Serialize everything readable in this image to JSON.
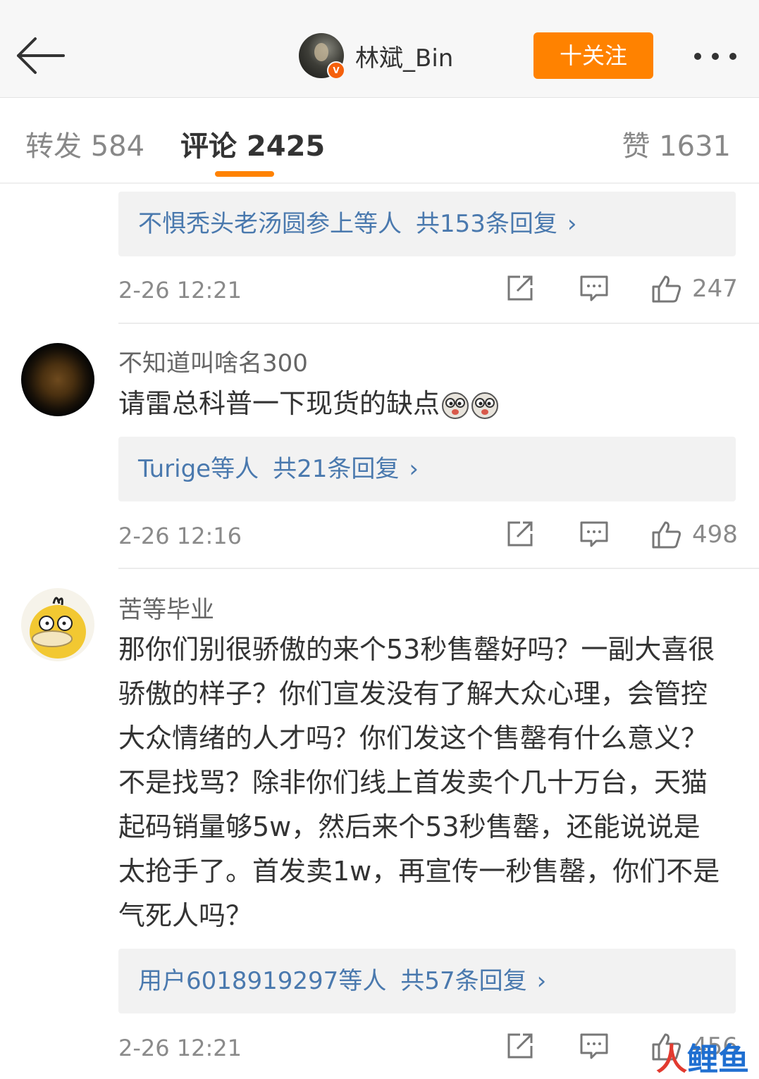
{
  "header": {
    "username": "林斌_Bin",
    "verified_badge": "V",
    "follow_label": "十关注",
    "accent_color": "#ff8200"
  },
  "tabs": {
    "repost": "转发 584",
    "comment": "评论 2425",
    "like": "赞 1631",
    "active": "comment"
  },
  "comments": [
    {
      "partial": true,
      "replies": {
        "names": "不惧秃头老汤圆参上等人",
        "count": "共153条回复",
        "chevron": "›"
      },
      "time": "2-26 12:21",
      "likes": "247"
    },
    {
      "name": "不知道叫啥名300",
      "text": "请雷总科普一下现货的缺点",
      "emojis": [
        "doge-emoji",
        "doge-emoji"
      ],
      "replies": {
        "names": "Turige等人",
        "count": "共21条回复",
        "chevron": "›"
      },
      "time": "2-26 12:16",
      "likes": "498"
    },
    {
      "name": "苦等毕业",
      "text": "那你们别很骄傲的来个53秒售罄好吗？一副大喜很骄傲的样子？你们宣发没有了解大众心理，会管控大众情绪的人才吗？你们发这个售罄有什么意义？不是找骂？除非你们线上首发卖个几十万台，天猫起码销量够5w，然后来个53秒售罄，还能说说是太抢手了。首发卖1w，再宣传一秒售罄，你们不是气死人吗？",
      "replies": {
        "names": "用户6018919297等人",
        "count": "共57条回复",
        "chevron": "›"
      },
      "time": "2-26 12:21",
      "likes": "456"
    }
  ],
  "watermark": {
    "part1": "人",
    "part2": "鲤鱼"
  }
}
